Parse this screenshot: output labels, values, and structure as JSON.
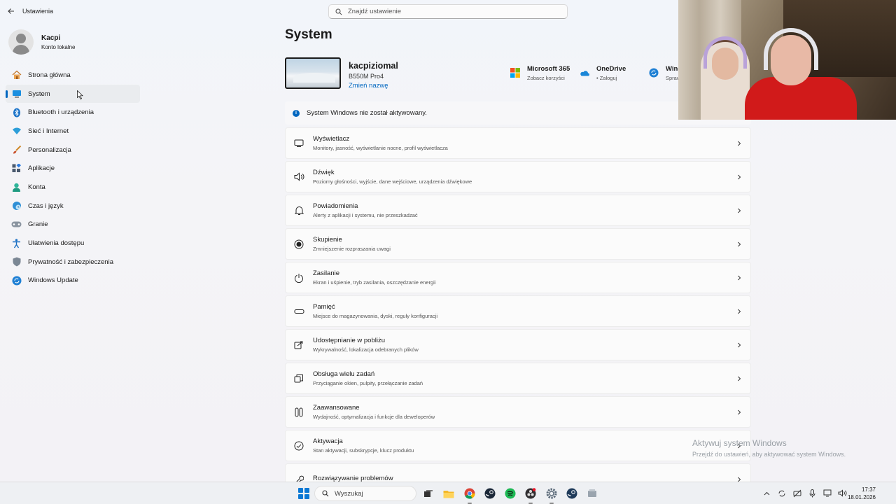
{
  "app": {
    "title": "Ustawienia"
  },
  "search": {
    "placeholder": "Znajdź ustawienie"
  },
  "profile": {
    "name": "Kacpi",
    "account_type": "Konto lokalne"
  },
  "sidebar": {
    "items": [
      {
        "label": "Strona główna",
        "icon": "home-icon",
        "active": false
      },
      {
        "label": "System",
        "icon": "system-icon",
        "active": true
      },
      {
        "label": "Bluetooth i urządzenia",
        "icon": "bluetooth-icon",
        "active": false
      },
      {
        "label": "Sieć i Internet",
        "icon": "network-icon",
        "active": false
      },
      {
        "label": "Personalizacja",
        "icon": "brush-icon",
        "active": false
      },
      {
        "label": "Aplikacje",
        "icon": "apps-icon",
        "active": false
      },
      {
        "label": "Konta",
        "icon": "account-icon",
        "active": false
      },
      {
        "label": "Czas i język",
        "icon": "time-language-icon",
        "active": false
      },
      {
        "label": "Granie",
        "icon": "gamepad-icon",
        "active": false
      },
      {
        "label": "Ułatwienia dostępu",
        "icon": "accessibility-icon",
        "active": false
      },
      {
        "label": "Prywatność i zabezpieczenia",
        "icon": "shield-icon",
        "active": false
      },
      {
        "label": "Windows Update",
        "icon": "update-icon",
        "active": false
      }
    ]
  },
  "main": {
    "title": "System",
    "device": {
      "name": "kacpiziomal",
      "model": "B550M Pro4",
      "rename_label": "Zmień nazwę"
    },
    "quick_links": [
      {
        "title": "Microsoft 365",
        "subtitle": "Zobacz korzyści",
        "icon": "microsoft365-icon"
      },
      {
        "title": "OneDrive",
        "subtitle": "• Zaloguj",
        "icon": "onedrive-icon"
      },
      {
        "title": "Wind",
        "subtitle": "Spraw",
        "icon": "windows-update-icon"
      }
    ],
    "activation_notice": "System Windows nie został aktywowany.",
    "cards": [
      {
        "title": "Wyświetlacz",
        "subtitle": "Monitory, jasność, wyświetlanie nocne, profil wyświetlacza",
        "icon": "display-icon"
      },
      {
        "title": "Dźwięk",
        "subtitle": "Poziomy głośności, wyjście, dane wejściowe, urządzenia dźwiękowe",
        "icon": "sound-icon"
      },
      {
        "title": "Powiadomienia",
        "subtitle": "Alerty z aplikacji i systemu, nie przeszkadzać",
        "icon": "bell-icon"
      },
      {
        "title": "Skupienie",
        "subtitle": "Zmniejszenie rozpraszania uwagi",
        "icon": "focus-icon"
      },
      {
        "title": "Zasilanie",
        "subtitle": "Ekran i uśpienie, tryb zasilania, oszczędzanie energii",
        "icon": "power-icon"
      },
      {
        "title": "Pamięć",
        "subtitle": "Miejsce do magazynowania, dyski, reguły konfiguracji",
        "icon": "storage-icon"
      },
      {
        "title": "Udostępnianie w pobliżu",
        "subtitle": "Wykrywalność, lokalizacja odebranych plików",
        "icon": "share-icon"
      },
      {
        "title": "Obsługa wielu zadań",
        "subtitle": "Przyciąganie okien, pulpity, przełączanie zadań",
        "icon": "multitask-icon"
      },
      {
        "title": "Zaawansowane",
        "subtitle": "Wydajność, optymalizacja i funkcje dla deweloperów",
        "icon": "advanced-icon"
      },
      {
        "title": "Aktywacja",
        "subtitle": "Stan aktywacji, subskrypcje, klucz produktu",
        "icon": "activation-icon"
      },
      {
        "title": "Rozwiązywanie problemów",
        "subtitle": "",
        "icon": "troubleshoot-icon"
      }
    ]
  },
  "watermark": {
    "title": "Aktywuj system Windows",
    "subtitle": "Przejdź do ustawień, aby aktywować system Windows."
  },
  "taskbar": {
    "search_label": "Wyszukaj",
    "apps": [
      "task-view-icon",
      "file-explorer-icon",
      "chrome-icon",
      "steam-icon",
      "spotify-icon",
      "obs-icon",
      "settings-icon",
      "steam-icon-2",
      "app-icon"
    ],
    "time": "17:37",
    "date": "18.01.2026"
  }
}
